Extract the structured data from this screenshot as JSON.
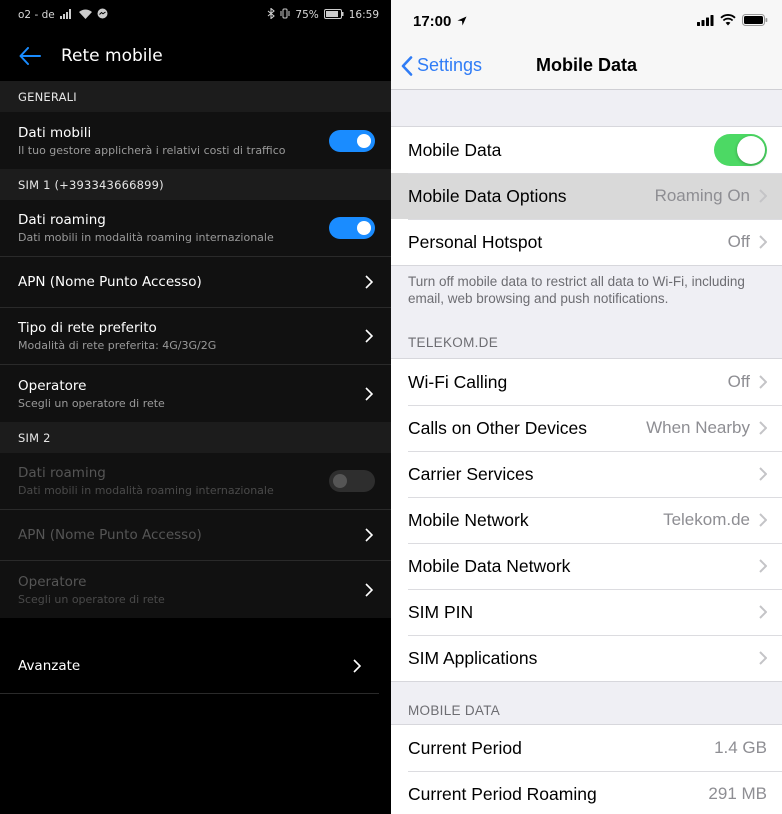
{
  "android": {
    "status": {
      "carrier": "o2 - de",
      "battery": "75%",
      "time": "16:59"
    },
    "header": {
      "title": "Rete mobile"
    },
    "sections": {
      "general": "GENERALI",
      "sim1": "SIM 1 (+393343666899)",
      "sim2": "SIM 2"
    },
    "items": {
      "mobile_data": {
        "title": "Dati mobili",
        "subtitle": "Il tuo gestore applicherà i relativi costi di traffico",
        "on": true
      },
      "sim1_roaming": {
        "title": "Dati roaming",
        "subtitle": "Dati mobili in modalità roaming internazionale",
        "on": true
      },
      "sim1_apn": {
        "title": "APN (Nome Punto Accesso)"
      },
      "sim1_network_type": {
        "title": "Tipo di rete preferito",
        "subtitle": "Modalità di rete preferita: 4G/3G/2G"
      },
      "sim1_operator": {
        "title": "Operatore",
        "subtitle": "Scegli un operatore di rete"
      },
      "sim2_roaming": {
        "title": "Dati roaming",
        "subtitle": "Dati mobili in modalità roaming internazionale",
        "on": false
      },
      "sim2_apn": {
        "title": "APN (Nome Punto Accesso)"
      },
      "sim2_operator": {
        "title": "Operatore",
        "subtitle": "Scegli un operatore di rete"
      },
      "advanced": {
        "title": "Avanzate"
      }
    },
    "colors": {
      "accent": "#1a8cff",
      "background": "#000000",
      "section": "#1c1c1c"
    }
  },
  "ios": {
    "status": {
      "time": "17:00"
    },
    "nav": {
      "back_label": "Settings",
      "title": "Mobile Data"
    },
    "group1": {
      "mobile_data": {
        "label": "Mobile Data",
        "on": true
      },
      "options": {
        "label": "Mobile Data Options",
        "value": "Roaming On"
      },
      "hotspot": {
        "label": "Personal Hotspot",
        "value": "Off"
      }
    },
    "group1_footer": "Turn off mobile data to restrict all data to Wi-Fi, including email, web browsing and push notifications.",
    "carrier_header": "TELEKOM.DE",
    "carrier_rows": {
      "wifi_calling": {
        "label": "Wi-Fi Calling",
        "value": "Off"
      },
      "calls_other": {
        "label": "Calls on Other Devices",
        "value": "When Nearby"
      },
      "carrier_services": {
        "label": "Carrier Services"
      },
      "mobile_network": {
        "label": "Mobile Network",
        "value": "Telekom.de"
      },
      "mobile_data_network": {
        "label": "Mobile Data Network"
      },
      "sim_pin": {
        "label": "SIM PIN"
      },
      "sim_apps": {
        "label": "SIM Applications"
      }
    },
    "usage_header": "MOBILE DATA",
    "usage_rows": {
      "current_period": {
        "label": "Current Period",
        "value": "1.4 GB"
      },
      "current_roaming": {
        "label": "Current Period Roaming",
        "value": "291 MB"
      }
    },
    "colors": {
      "accent": "#2f7cf6",
      "toggle_on": "#4cd964",
      "background": "#efeff4"
    }
  }
}
